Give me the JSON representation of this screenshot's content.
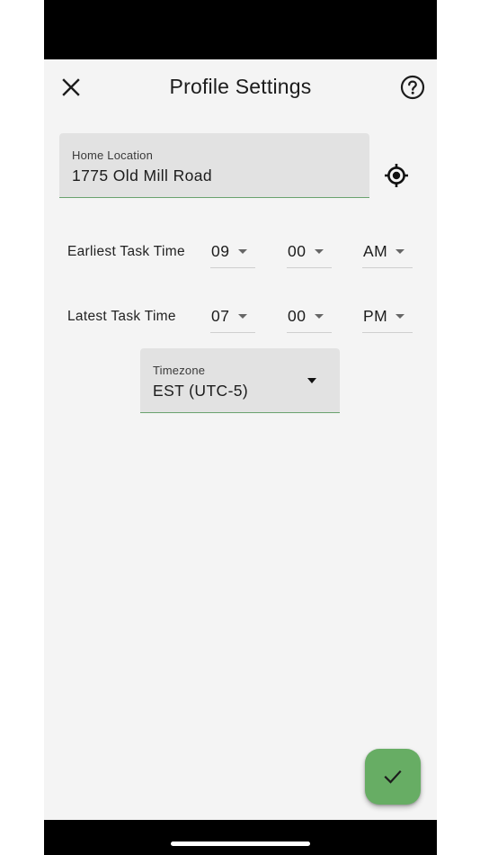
{
  "header": {
    "title": "Profile Settings",
    "close_icon": "close-icon",
    "help_icon": "help-circle-icon"
  },
  "home_location": {
    "label": "Home Location",
    "value": "1775 Old Mill Road",
    "locate_icon": "my-location-icon"
  },
  "earliest_task_time": {
    "label": "Earliest Task Time",
    "hour": "09",
    "minute": "00",
    "period": "AM"
  },
  "latest_task_time": {
    "label": "Latest Task Time",
    "hour": "07",
    "minute": "00",
    "period": "PM"
  },
  "timezone": {
    "label": "Timezone",
    "value": "EST (UTC-5)"
  },
  "save_fab": {
    "icon": "check-icon"
  },
  "colors": {
    "accent_green": "#67ad64",
    "field_underline": "#6aa26e",
    "field_background": "#e2e2e2",
    "page_background": "#f4f4f4"
  }
}
